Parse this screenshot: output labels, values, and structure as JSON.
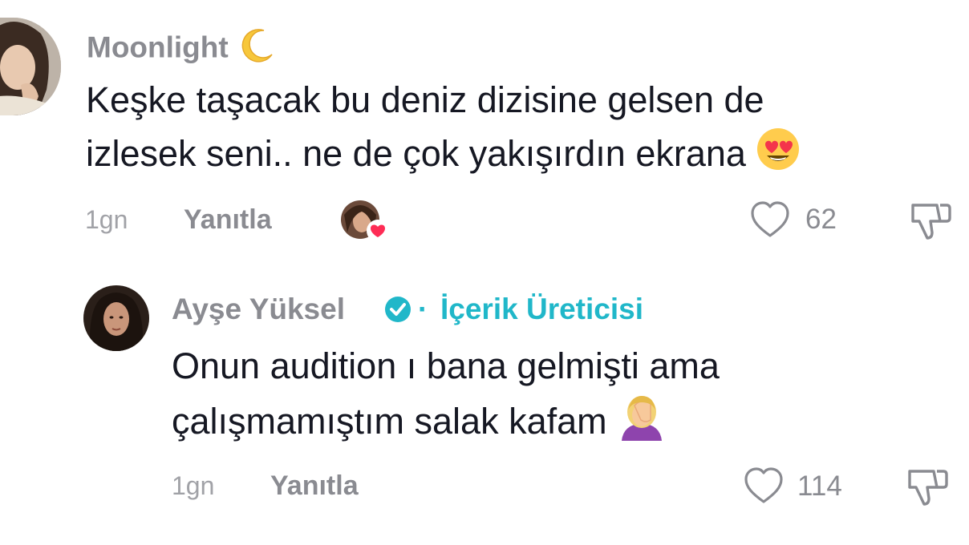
{
  "comments": [
    {
      "username": "Moonlight",
      "username_icon": "crescent-moon-icon",
      "text_line1": "Keşke taşacak bu deniz dizisine gelsen de",
      "text_line2": "izlesek seni.. ne de çok yakışırdın ekrana",
      "text_emoji": "heart-eyes-emoji",
      "time": "1gn",
      "reply_label": "Yanıtla",
      "liked_by_creator_icon": "creator-liked-heart-avatar-icon",
      "like_count": "62"
    },
    {
      "username": "Ayşe Yüksel",
      "verified_icon": "verified-badge-icon",
      "separator": "·",
      "role_label": "İçerik Üreticisi",
      "text_line1": "Onun audition ı bana gelmişti ama",
      "text_line2": "çalışmamıştım salak kafam",
      "text_emoji": "facepalm-emoji",
      "time": "1gn",
      "reply_label": "Yanıtla",
      "like_count": "114"
    }
  ],
  "colors": {
    "text_primary": "#161823",
    "text_secondary": "#8a8b91",
    "verified_accent": "#20b7c9",
    "heart_red": "#fe2c55"
  }
}
